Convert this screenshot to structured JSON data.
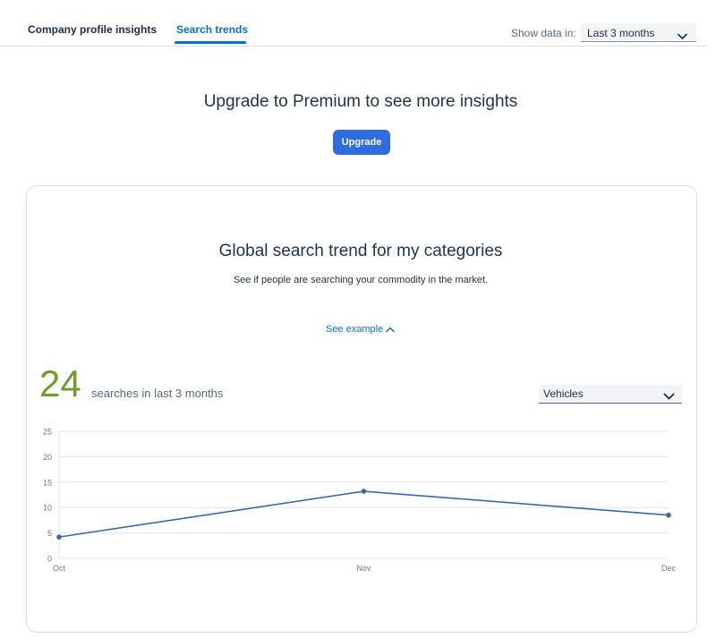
{
  "tabs": [
    {
      "label": "Company profile insights",
      "active": false
    },
    {
      "label": "Search trends",
      "active": true
    }
  ],
  "filter": {
    "label": "Show data in:",
    "selected": "Last 3 months"
  },
  "upgrade": {
    "title": "Upgrade to Premium to see more insights",
    "button_label": "Upgrade"
  },
  "card": {
    "title": "Global search trend for my categories",
    "subtitle": "See if people are searching your commodity in the market.",
    "see_example": "See example",
    "count": "24",
    "count_label": "searches in last 3 months",
    "category_selected": "Vehicles"
  },
  "colors": {
    "accent": "#0a6ed1",
    "button": "#2f6cdd",
    "count": "#6d9e2c",
    "line": "#3b69a5"
  },
  "chart_data": {
    "type": "line",
    "categories": [
      "Oct",
      "Nov",
      "Dec"
    ],
    "series": [
      {
        "values": [
          4.2,
          13.2,
          8.5
        ]
      }
    ],
    "y_ticks": [
      0,
      5,
      10,
      15,
      20,
      25
    ],
    "ylim": [
      0,
      25
    ],
    "grid": true,
    "legend": "none"
  }
}
